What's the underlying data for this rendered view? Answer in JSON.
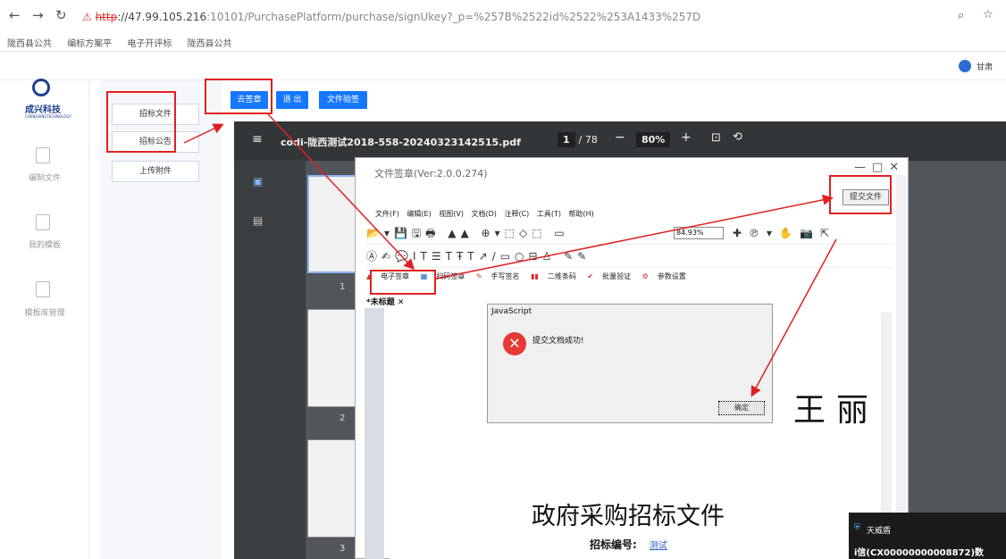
{
  "browser": {
    "url_scheme": "http",
    "url_rest": "://47.99.105.216",
    "url_path": ":10101/PurchasePlatform/purchase/signUkey?_p=%257B%2522id%2522%253A1433%257D",
    "bookmarks": [
      "陇西县公共",
      "编标方案平",
      "电子开评标",
      "陇西县公共"
    ]
  },
  "user": {
    "name": "甘肃"
  },
  "sidebar": {
    "logo_text": "成兴科技",
    "logo_sub": "CHENGXINGTECHNOLOGY",
    "items": [
      {
        "label": "编制文件",
        "icon": "file-icon"
      },
      {
        "label": "我的模板",
        "icon": "template-icon"
      },
      {
        "label": "模板库管理",
        "icon": "library-icon"
      }
    ]
  },
  "doc_buttons": [
    "招标文件",
    "招标公告",
    "上传附件"
  ],
  "top_buttons": {
    "sign": "去签章",
    "logout": "退 出",
    "verify": "文件验签"
  },
  "pdf": {
    "filename": "codi-陇西测试2018-558-20240323142515.pdf",
    "page_current": "1",
    "page_total": "/ 78",
    "zoom": "80%",
    "thumb_numbers": [
      "1",
      "2",
      "3"
    ]
  },
  "sign_app": {
    "title": "文件签章(Ver:2.0.0.274)",
    "submit_label": "提交文件",
    "menus": [
      "文件(F)",
      "编辑(E)",
      "视图(V)",
      "文档(D)",
      "注释(C)",
      "工具(T)",
      "帮助(H)"
    ],
    "zoom_value": "84.93%",
    "sig_tools": [
      "电子签章",
      "扫码签章",
      "手写签名",
      "二维条码",
      "批量验证",
      "参数设置"
    ],
    "tab_name": "*未标题"
  },
  "js_dialog": {
    "title": "JavaScript",
    "message": "提交文档成功!",
    "ok_label": "确定"
  },
  "document": {
    "signature": "王丽",
    "title": "政府采购招标文件",
    "bid_label": "招标编号:",
    "bid_value": "测试"
  },
  "toast": {
    "title": "天威盾",
    "message": "i信(CX00000000008872)数"
  }
}
